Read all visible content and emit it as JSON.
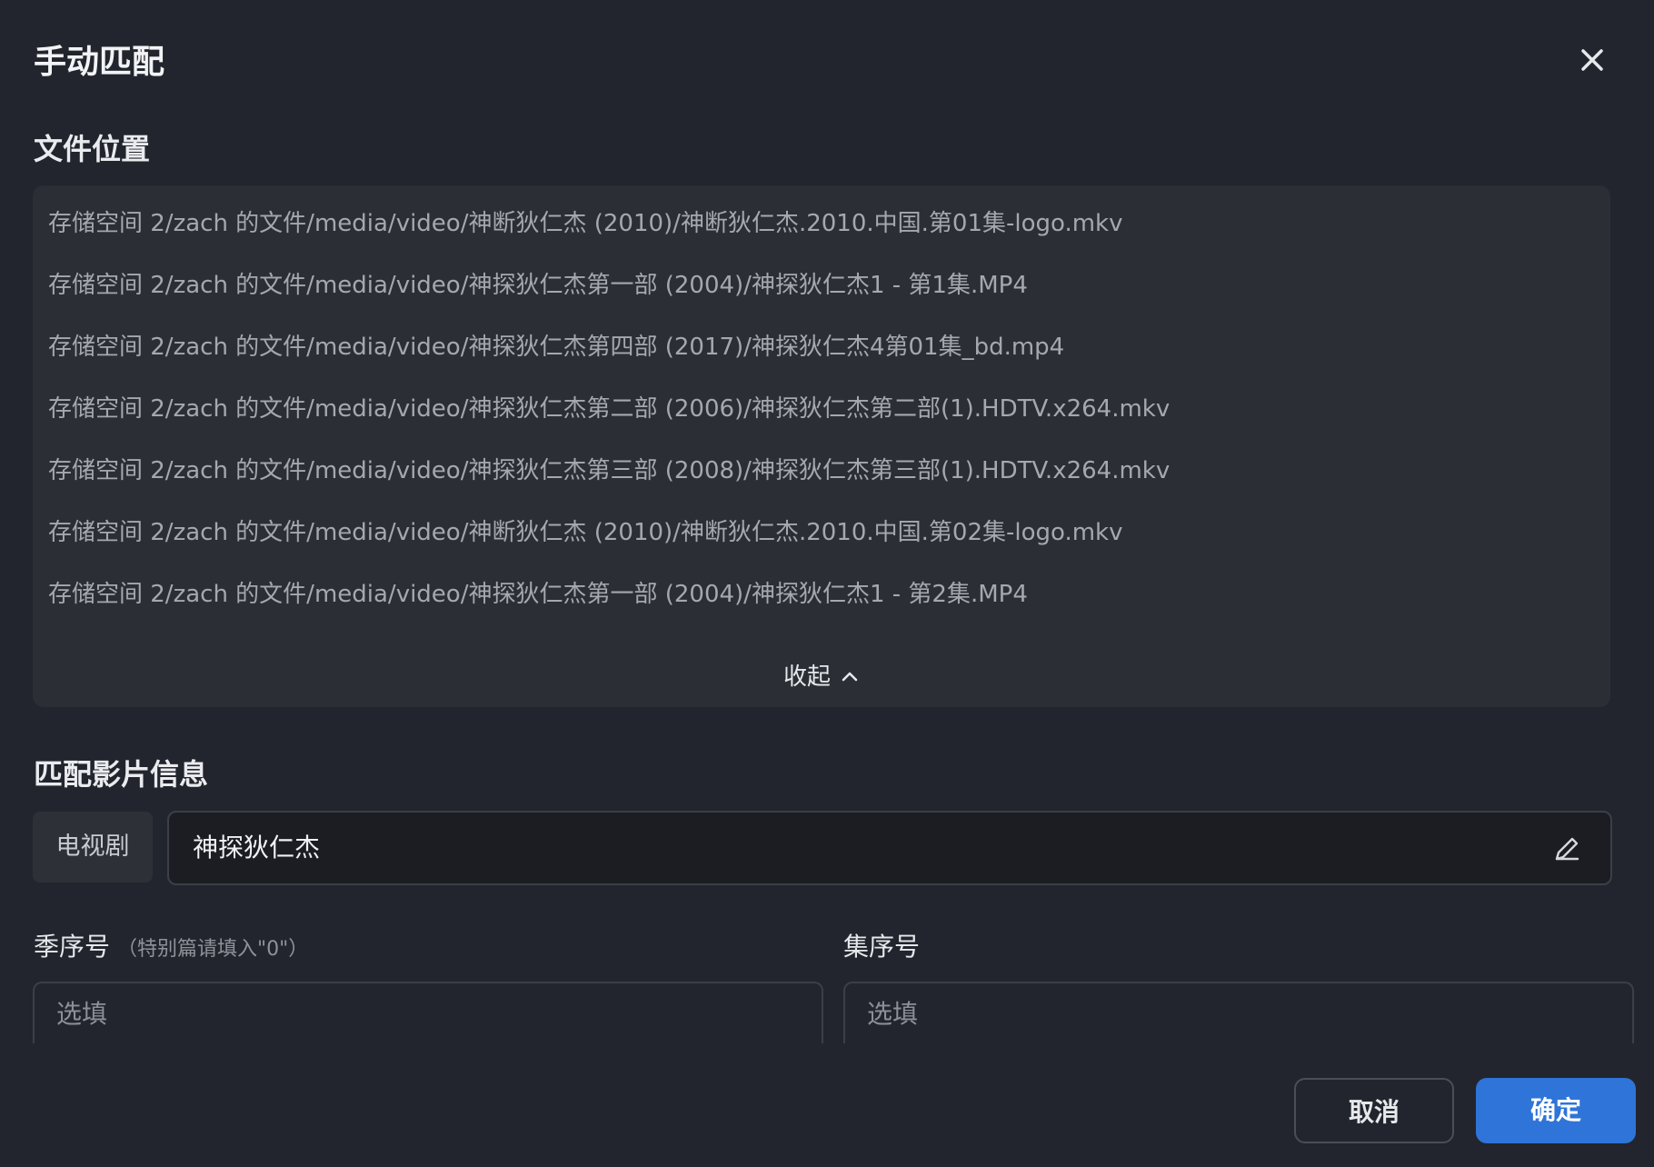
{
  "dialog": {
    "title": "手动匹配"
  },
  "file_location": {
    "label": "文件位置",
    "files": [
      "存储空间 2/zach 的文件/media/video/神断狄仁杰 (2010)/神断狄仁杰.2010.中国.第01集-logo.mkv",
      "存储空间 2/zach 的文件/media/video/神探狄仁杰第一部 (2004)/神探狄仁杰1 - 第1集.MP4",
      "存储空间 2/zach 的文件/media/video/神探狄仁杰第四部 (2017)/神探狄仁杰4第01集_bd.mp4",
      "存储空间 2/zach 的文件/media/video/神探狄仁杰第二部 (2006)/神探狄仁杰第二部(1).HDTV.x264.mkv",
      "存储空间 2/zach 的文件/media/video/神探狄仁杰第三部 (2008)/神探狄仁杰第三部(1).HDTV.x264.mkv",
      "存储空间 2/zach 的文件/media/video/神断狄仁杰 (2010)/神断狄仁杰.2010.中国.第02集-logo.mkv",
      "存储空间 2/zach 的文件/media/video/神探狄仁杰第一部 (2004)/神探狄仁杰1 - 第2集.MP4"
    ],
    "collapse_label": "收起"
  },
  "match_info": {
    "label": "匹配影片信息",
    "type": "电视剧",
    "title_value": "神探狄仁杰"
  },
  "season": {
    "label": "季序号",
    "hint": "（特别篇请填入\"0\"）",
    "placeholder": "选填"
  },
  "episode": {
    "label": "集序号",
    "placeholder": "选填"
  },
  "actions": {
    "cancel_label": "取消",
    "confirm_label": "确定"
  },
  "colors": {
    "background": "#22252d",
    "panel": "#2b2e35",
    "accent": "#2f74d8"
  }
}
